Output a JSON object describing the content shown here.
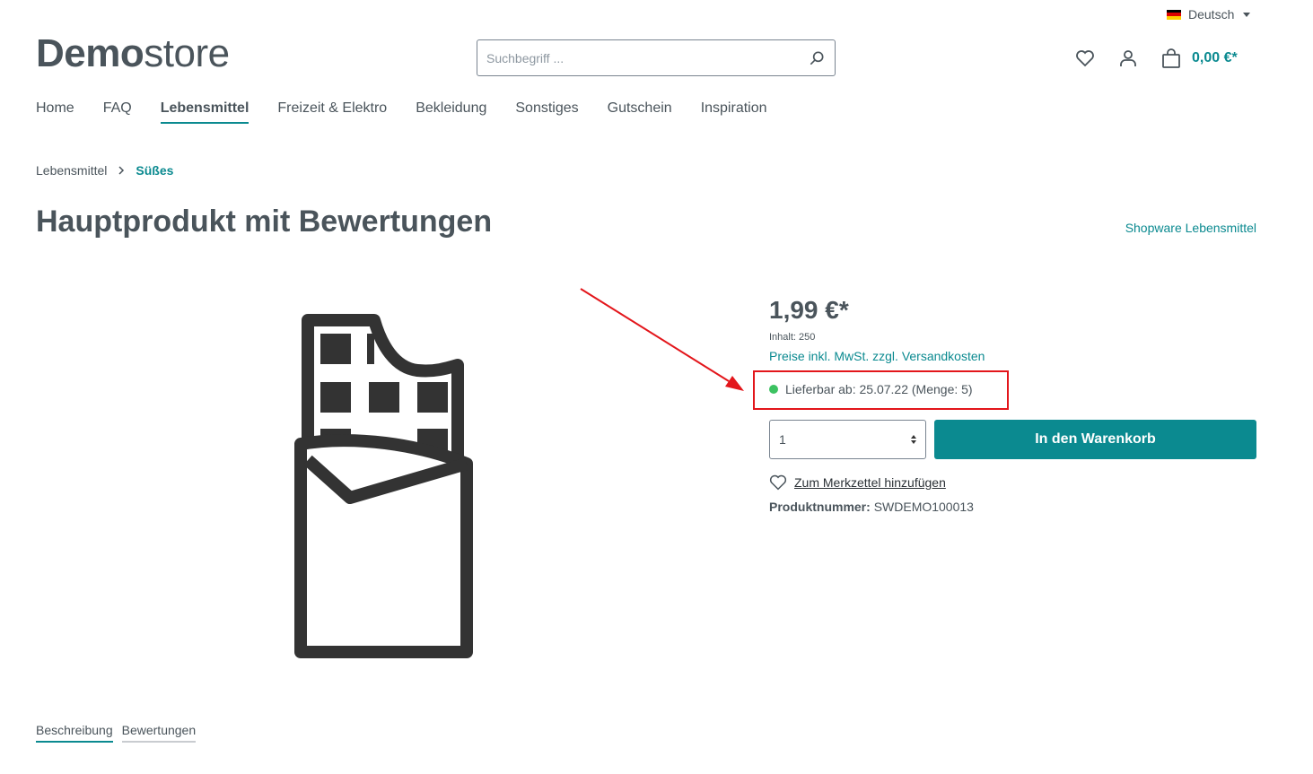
{
  "language": {
    "label": "Deutsch",
    "flag_colors": [
      "#000000",
      "#dd0000",
      "#ffce00"
    ]
  },
  "logo": {
    "bold": "Demo",
    "light": "store"
  },
  "search": {
    "placeholder": "Suchbegriff ..."
  },
  "header": {
    "cart_total": "0,00 €*"
  },
  "nav": {
    "items": [
      {
        "label": "Home",
        "active": false
      },
      {
        "label": "FAQ",
        "active": false
      },
      {
        "label": "Lebensmittel",
        "active": true
      },
      {
        "label": "Freizeit & Elektro",
        "active": false
      },
      {
        "label": "Bekleidung",
        "active": false
      },
      {
        "label": "Sonstiges",
        "active": false
      },
      {
        "label": "Gutschein",
        "active": false
      },
      {
        "label": "Inspiration",
        "active": false
      }
    ]
  },
  "breadcrumb": {
    "parent": "Lebensmittel",
    "current": "Süßes"
  },
  "product": {
    "title": "Hauptprodukt mit Bewertungen",
    "manufacturer": "Shopware Lebensmittel",
    "price": "1,99 €*",
    "content_info": "Inhalt: 250",
    "tax_link": "Preise inkl. MwSt. zzgl. Versandkosten",
    "delivery": "Lieferbar ab: 25.07.22 (Menge: 5)",
    "quantity": "1",
    "buy_label": "In den Warenkorb",
    "wishlist_label": "Zum Merkzettel hinzufügen",
    "number_label": "Produktnummer:",
    "number_value": "SWDEMO100013"
  },
  "tabs": [
    {
      "label": "Beschreibung",
      "active": true
    },
    {
      "label": "Bewertungen",
      "active": false
    }
  ],
  "colors": {
    "accent": "#0b8a90",
    "annotation": "#e3161b",
    "available": "#3cc261"
  }
}
